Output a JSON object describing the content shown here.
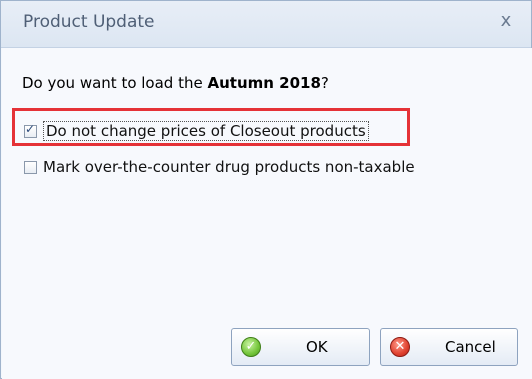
{
  "dialog": {
    "title": "Product Update",
    "close_glyph": "x",
    "question_prefix": "Do you want to load the ",
    "question_bold": "Autumn 2018",
    "question_suffix": "?"
  },
  "options": [
    {
      "label": "Do not change prices of Closeout products",
      "checked": true
    },
    {
      "label": "Mark over-the-counter drug products non-taxable",
      "checked": false
    }
  ],
  "buttons": {
    "ok_label": "OK",
    "cancel_label": "Cancel",
    "ok_icon": "check-icon",
    "cancel_icon": "x-circle-icon"
  },
  "colors": {
    "highlight": "#e53237"
  }
}
